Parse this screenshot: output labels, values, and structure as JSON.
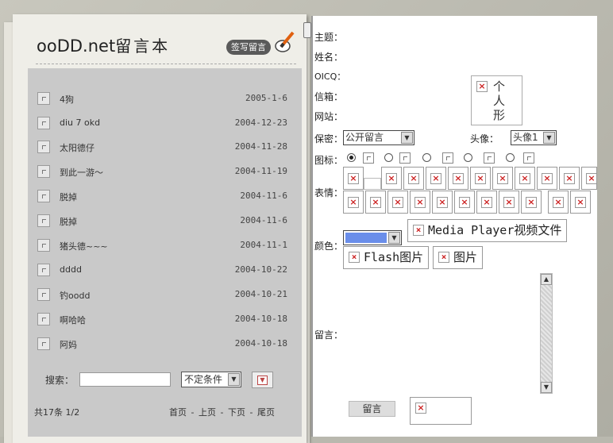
{
  "header": {
    "logo_latin": "ooDD.net",
    "logo_cn": "留言本",
    "write_button": "签写留言"
  },
  "list": {
    "items": [
      {
        "title": "4狗",
        "date": "2005-1-6"
      },
      {
        "title": "diu 7 okd",
        "date": "2004-12-23"
      },
      {
        "title": "太阳德仔",
        "date": "2004-11-28"
      },
      {
        "title": "到此一游～",
        "date": "2004-11-19"
      },
      {
        "title": "脱掉",
        "date": "2004-11-6"
      },
      {
        "title": "脱掉",
        "date": "2004-11-6"
      },
      {
        "title": "猪头德~~~",
        "date": "2004-11-1"
      },
      {
        "title": "dddd",
        "date": "2004-10-22"
      },
      {
        "title": "钓oodd",
        "date": "2004-10-21"
      },
      {
        "title": "啊哈哈",
        "date": "2004-10-18"
      },
      {
        "title": "阿妈",
        "date": "2004-10-18"
      }
    ]
  },
  "search": {
    "label": "搜索：",
    "input_value": "",
    "condition": "不定条件",
    "dropdown_arrow": "▼"
  },
  "footer": {
    "total": "共17条 1/2",
    "first": "首页",
    "prev": "上页",
    "next": "下页",
    "last": "尾页",
    "sep": "-"
  },
  "form": {
    "subject_label": "主题：",
    "name_label": "姓名：",
    "oicq_label": "OICQ：",
    "email_label": "信箱：",
    "website_label": "网站：",
    "privacy_label": "保密：",
    "privacy_value": "公开留言",
    "avatar_label": "头像：",
    "avatar_value": "头像1",
    "avatar_preview_text": "个人形",
    "icon_label": "图标：",
    "emote_label": "表情：",
    "color_label": "颜色：",
    "color_value": "#6a8eea",
    "media_player_button": "Media Player视频文件",
    "flash_button": "Flash图片",
    "image_button": "图片",
    "message_label": "留言：",
    "message_value": "",
    "submit_button": "留言",
    "broken_image_glyph": "×",
    "scroll_up": "▲",
    "scroll_down": "▼"
  }
}
